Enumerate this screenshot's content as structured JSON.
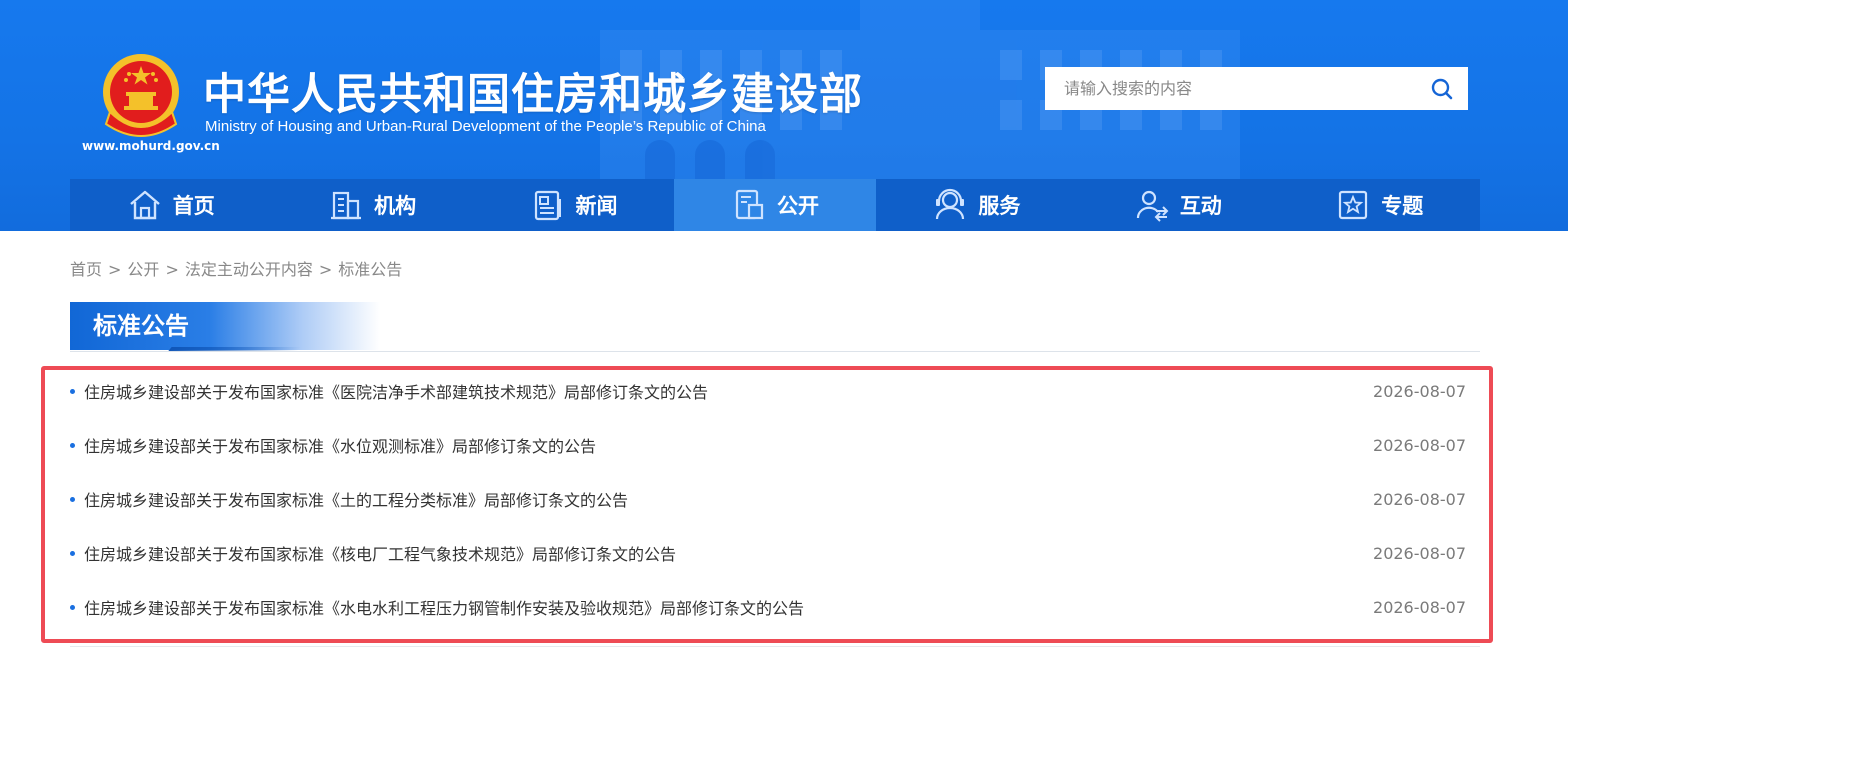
{
  "header": {
    "title": "中华人民共和国住房和城乡建设部",
    "subtitle": "Ministry of Housing and Urban-Rural Development of the People’s Republic of China",
    "site_url": "www.mohurd.gov.cn",
    "emblem_icon": "national-emblem-icon"
  },
  "search": {
    "placeholder": "请输入搜索的内容",
    "value": "",
    "icon": "search-icon"
  },
  "nav": {
    "items": [
      {
        "label": "首页",
        "icon": "home-icon",
        "active": false
      },
      {
        "label": "机构",
        "icon": "building-icon",
        "active": false
      },
      {
        "label": "新闻",
        "icon": "news-icon",
        "active": false
      },
      {
        "label": "公开",
        "icon": "disclosure-icon",
        "active": true
      },
      {
        "label": "服务",
        "icon": "service-icon",
        "active": false
      },
      {
        "label": "互动",
        "icon": "interaction-icon",
        "active": false
      },
      {
        "label": "专题",
        "icon": "topic-icon",
        "active": false
      }
    ]
  },
  "breadcrumb": {
    "items": [
      "首页",
      "公开",
      "法定主动公开内容",
      "标准公告"
    ],
    "separator": ">"
  },
  "section": {
    "title": "标准公告"
  },
  "announcements": [
    {
      "title": "住房城乡建设部关于发布国家标准《医院洁净手术部建筑技术规范》局部修订条文的公告",
      "date": "2026-08-07"
    },
    {
      "title": "住房城乡建设部关于发布国家标准《水位观测标准》局部修订条文的公告",
      "date": "2026-08-07"
    },
    {
      "title": "住房城乡建设部关于发布国家标准《土的工程分类标准》局部修订条文的公告",
      "date": "2026-08-07"
    },
    {
      "title": "住房城乡建设部关于发布国家标准《核电厂工程气象技术规范》局部修订条文的公告",
      "date": "2026-08-07"
    },
    {
      "title": "住房城乡建设部关于发布国家标准《水电水利工程压力钢管制作安装及验收规范》局部修订条文的公告",
      "date": "2026-08-07"
    }
  ],
  "colors": {
    "header_blue": "#1473e6",
    "nav_blue": "#0f5fc9",
    "nav_active": "#2f86e6",
    "highlight_frame": "#ee4b55",
    "bullet": "#1a6fe0"
  }
}
